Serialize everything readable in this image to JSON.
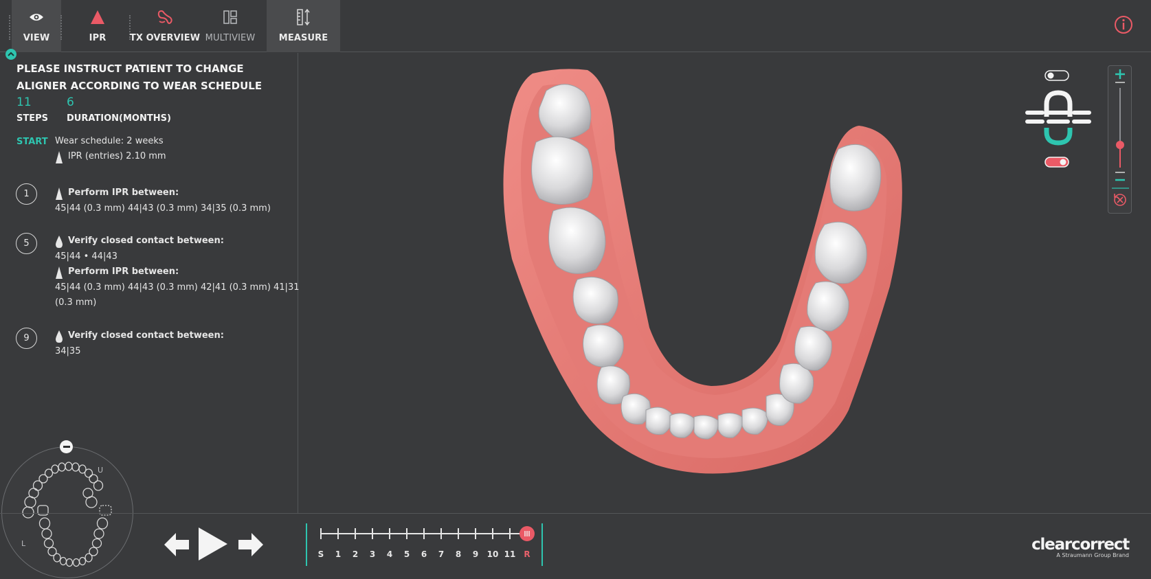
{
  "toolbar": {
    "tools": [
      {
        "label": "VIEW",
        "icon": "eye-icon"
      },
      {
        "label": "IPR",
        "icon": "ipr-triangle-icon"
      },
      {
        "label": "TX OVERVIEW",
        "icon": "tx-overview-icon"
      },
      {
        "label": "MULTIVIEW",
        "icon": "multiview-icon"
      },
      {
        "label": "MEASURE",
        "icon": "measure-icon"
      }
    ],
    "active_tool": "MEASURE"
  },
  "instructions": {
    "headline": "PLEASE INSTRUCT PATIENT TO CHANGE ALIGNER ACCORDING TO WEAR SCHEDULE",
    "steps_value": "11",
    "steps_label": "STEPS",
    "duration_value": "6",
    "duration_label": "DURATION(MONTHS)",
    "start_label": "START",
    "wear_schedule": "Wear schedule: 2 weeks",
    "ipr_entries": "IPR (entries) 2.10 mm",
    "items": [
      {
        "step": "1",
        "lines": [
          {
            "title": "Perform IPR between:",
            "detail": "45|44 (0.3 mm) 44|43 (0.3 mm) 34|35 (0.3 mm)"
          }
        ]
      },
      {
        "step": "5",
        "lines": [
          {
            "title": "Verify closed contact between:",
            "detail": "45|44 • 44|43"
          },
          {
            "title": "Perform IPR between:",
            "detail": "45|44 (0.3 mm) 44|43 (0.3 mm) 42|41 (0.3 mm) 41|31",
            "detail2": "(0.3 mm)"
          }
        ]
      },
      {
        "step": "9",
        "lines": [
          {
            "title": "Verify closed contact between:",
            "detail": "34|35"
          }
        ]
      }
    ]
  },
  "arch_navigator": {
    "upper_label": "U",
    "left_label": "L"
  },
  "timeline": {
    "labels": [
      "S",
      "1",
      "2",
      "3",
      "4",
      "5",
      "6",
      "7",
      "8",
      "9",
      "10",
      "11",
      "R"
    ],
    "current": "R",
    "highlight_color": "#e8616b"
  },
  "brand": {
    "name": "clearcorrect",
    "tagline": "A Straumann Group Brand"
  },
  "colors": {
    "accent": "#2ec5b0",
    "ipr_red": "#ea5a66",
    "gum": "#e07a76",
    "background": "#393a3c"
  }
}
